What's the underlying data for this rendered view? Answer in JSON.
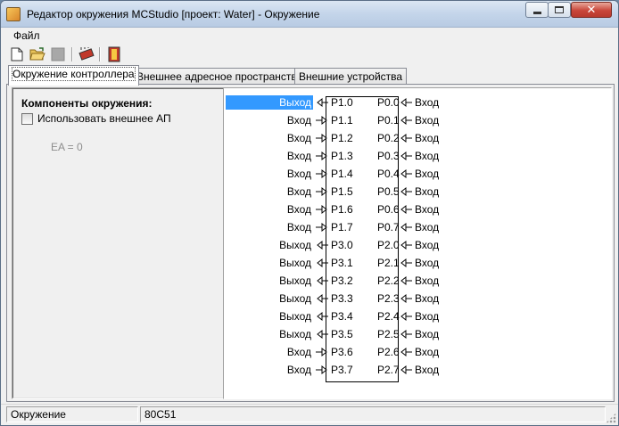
{
  "window": {
    "title": "Редактор окружения MCStudio [проект: Water] - Окружение"
  },
  "menu": {
    "file": "Файл"
  },
  "toolbar": {
    "buttons": [
      "new-file-icon",
      "open-folder-icon",
      "save-disabled-icon",
      "chip-icon",
      "exit-door-icon"
    ]
  },
  "tabs": [
    {
      "label": "Окружение контроллера",
      "active": true
    },
    {
      "label": "Внешнее адресное пространство",
      "active": false
    },
    {
      "label": "Внешние устройства",
      "active": false
    }
  ],
  "env": {
    "title": "Компоненты окружения:",
    "use_external_label": "Использовать внешнее АП",
    "use_external_checked": false,
    "ea_text": "EA = 0"
  },
  "pins": [
    {
      "left_dir": "Выход",
      "left_pin": "P1.0",
      "right_pin": "P0.0",
      "right_dir": "Вход",
      "left_out": true,
      "selected": true
    },
    {
      "left_dir": "Вход",
      "left_pin": "P1.1",
      "right_pin": "P0.1",
      "right_dir": "Вход",
      "left_out": false
    },
    {
      "left_dir": "Вход",
      "left_pin": "P1.2",
      "right_pin": "P0.2",
      "right_dir": "Вход",
      "left_out": false
    },
    {
      "left_dir": "Вход",
      "left_pin": "P1.3",
      "right_pin": "P0.3",
      "right_dir": "Вход",
      "left_out": false
    },
    {
      "left_dir": "Вход",
      "left_pin": "P1.4",
      "right_pin": "P0.4",
      "right_dir": "Вход",
      "left_out": false
    },
    {
      "left_dir": "Вход",
      "left_pin": "P1.5",
      "right_pin": "P0.5",
      "right_dir": "Вход",
      "left_out": false
    },
    {
      "left_dir": "Вход",
      "left_pin": "P1.6",
      "right_pin": "P0.6",
      "right_dir": "Вход",
      "left_out": false
    },
    {
      "left_dir": "Вход",
      "left_pin": "P1.7",
      "right_pin": "P0.7",
      "right_dir": "Вход",
      "left_out": false
    },
    {
      "left_dir": "Выход",
      "left_pin": "P3.0",
      "right_pin": "P2.0",
      "right_dir": "Вход",
      "left_out": true
    },
    {
      "left_dir": "Выход",
      "left_pin": "P3.1",
      "right_pin": "P2.1",
      "right_dir": "Вход",
      "left_out": true
    },
    {
      "left_dir": "Выход",
      "left_pin": "P3.2",
      "right_pin": "P2.2",
      "right_dir": "Вход",
      "left_out": true
    },
    {
      "left_dir": "Выход",
      "left_pin": "P3.3",
      "right_pin": "P2.3",
      "right_dir": "Вход",
      "left_out": true
    },
    {
      "left_dir": "Выход",
      "left_pin": "P3.4",
      "right_pin": "P2.4",
      "right_dir": "Вход",
      "left_out": true
    },
    {
      "left_dir": "Выход",
      "left_pin": "P3.5",
      "right_pin": "P2.5",
      "right_dir": "Вход",
      "left_out": true
    },
    {
      "left_dir": "Вход",
      "left_pin": "P3.6",
      "right_pin": "P2.6",
      "right_dir": "Вход",
      "left_out": false
    },
    {
      "left_dir": "Вход",
      "left_pin": "P3.7",
      "right_pin": "P2.7",
      "right_dir": "Вход",
      "left_out": false
    }
  ],
  "status": {
    "section": "Окружение",
    "chip": "80C51"
  }
}
